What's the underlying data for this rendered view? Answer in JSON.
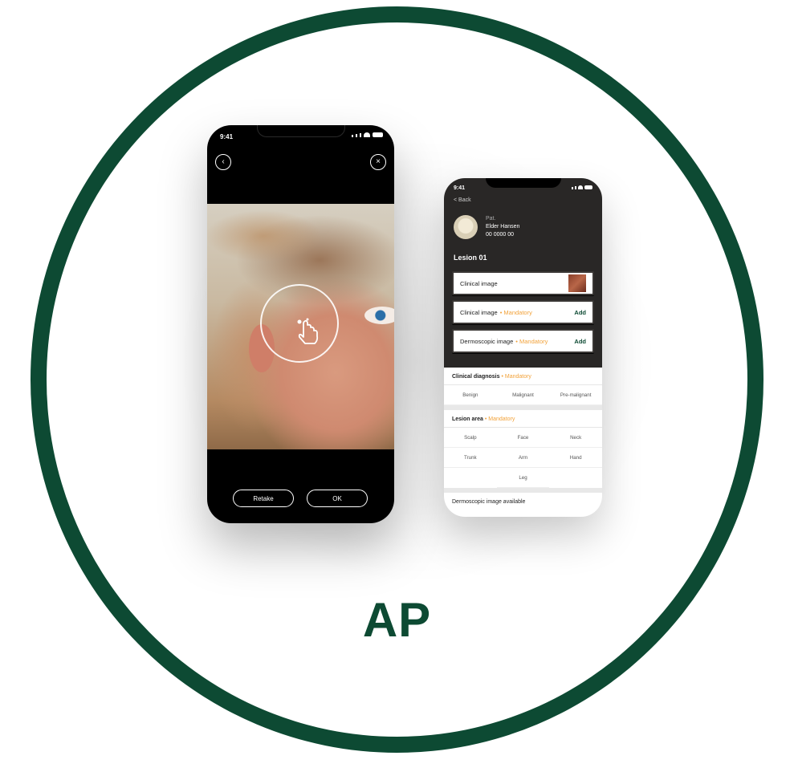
{
  "brand": {
    "text": "AP",
    "ring_color": "#0d4a33"
  },
  "camera_phone": {
    "status_time": "9:41",
    "back_icon": "chevron-left-icon",
    "close_icon": "close-icon",
    "focus_icon": "hand-pointer-icon",
    "buttons": {
      "retake": "Retake",
      "ok": "OK"
    }
  },
  "detail_phone": {
    "status_time": "9:41",
    "back_label": "< Back",
    "patient": {
      "label": "Pat.",
      "name": "Elder Hansen",
      "id": "00 0000 00"
    },
    "lesion_title": "Lesion 01",
    "image_rows": [
      {
        "label": "Clinical image",
        "mandatory": "",
        "action": ""
      },
      {
        "label": "Clinical image",
        "mandatory": "• Mandatory",
        "action": "Add"
      },
      {
        "label": "Dermoscopic image",
        "mandatory": "• Mandatory",
        "action": "Add"
      }
    ],
    "clinical_diagnosis": {
      "title": "Clinical diagnosis",
      "mandatory": "• Mandatory",
      "options": [
        "Benign",
        "Malignant",
        "Pre-malignant"
      ]
    },
    "lesion_area": {
      "title": "Lesion area",
      "mandatory": "• Mandatory",
      "options": [
        "Scalp",
        "Face",
        "Neck",
        "Trunk",
        "Arm",
        "Hand",
        "Leg"
      ]
    },
    "footer_text": "Dermoscopic image available"
  }
}
